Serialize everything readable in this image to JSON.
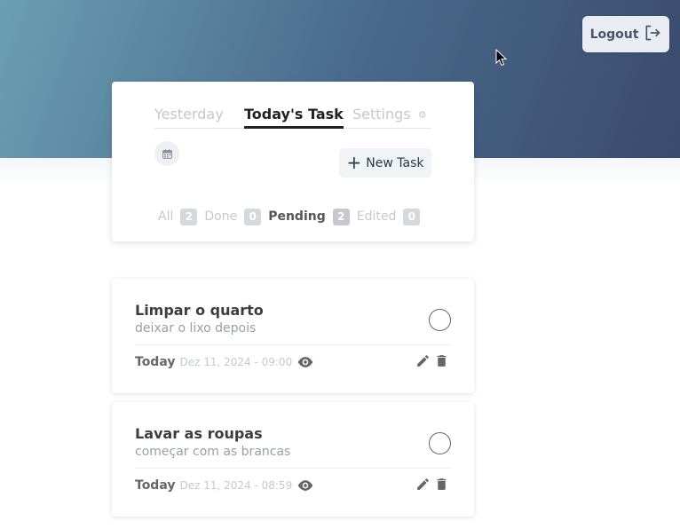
{
  "header": {
    "logout_label": "Logout",
    "logout_icon": "logout-icon"
  },
  "tabs": [
    {
      "label": "Yesterday",
      "active": false
    },
    {
      "label": "Today's Task",
      "active": true
    },
    {
      "label": "Settings",
      "active": false,
      "icon": "gear-icon"
    }
  ],
  "toolbar": {
    "calendar_icon": "calendar-icon",
    "new_task_label": "New Task"
  },
  "filters": [
    {
      "label": "All",
      "count": "2",
      "active": false
    },
    {
      "label": "Done",
      "count": "0",
      "active": false
    },
    {
      "label": "Pending",
      "count": "2",
      "active": true
    },
    {
      "label": "Edited",
      "count": "0",
      "active": false
    }
  ],
  "tasks": [
    {
      "title": "Limpar o quarto",
      "description": "deixar o lixo depois",
      "day": "Today",
      "date": "Dez 11, 2024 - 09:00"
    },
    {
      "title": "Lavar as roupas",
      "description": "começar com as brancas",
      "day": "Today",
      "date": "Dez 11, 2024 - 08:59"
    }
  ],
  "colors": {
    "hero_start": "#6a9fb3",
    "hero_end": "#3a4a6c",
    "text_dark": "#222222",
    "text_muted": "#c5c9cf"
  }
}
